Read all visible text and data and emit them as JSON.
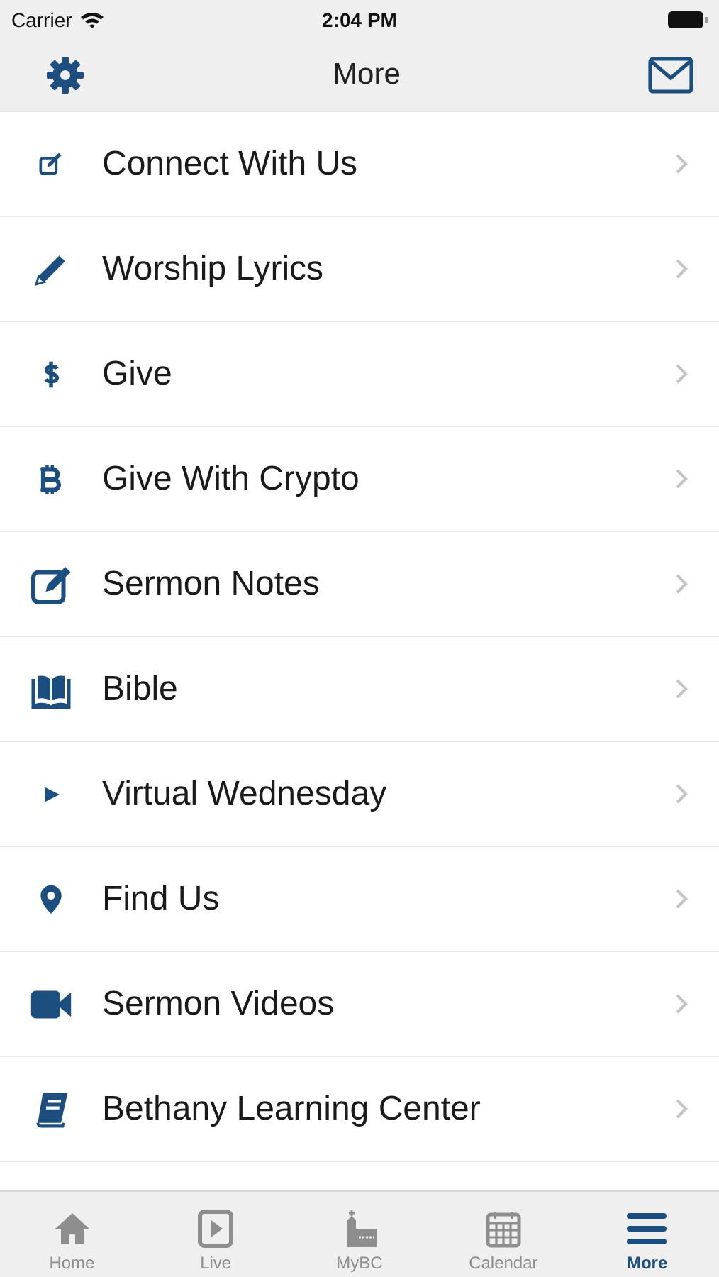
{
  "status_bar": {
    "carrier": "Carrier",
    "time": "2:04 PM"
  },
  "nav_bar": {
    "title": "More"
  },
  "menu_items": [
    {
      "label": "Connect With Us",
      "kind": "edit-small"
    },
    {
      "label": "Worship Lyrics",
      "kind": "pencil"
    },
    {
      "label": "Give",
      "kind": "dollar"
    },
    {
      "label": "Give With Crypto",
      "kind": "bitcoin"
    },
    {
      "label": "Sermon Notes",
      "kind": "edit"
    },
    {
      "label": "Bible",
      "kind": "book-open"
    },
    {
      "label": "Virtual Wednesday",
      "kind": "play"
    },
    {
      "label": "Find Us",
      "kind": "pin"
    },
    {
      "label": "Sermon Videos",
      "kind": "video"
    },
    {
      "label": "Bethany Learning Center",
      "kind": "book"
    }
  ],
  "tab_bar": [
    {
      "label": "Home",
      "kind": "home",
      "selected": false
    },
    {
      "label": "Live",
      "kind": "live",
      "selected": false
    },
    {
      "label": "MyBC",
      "kind": "church",
      "selected": false
    },
    {
      "label": "Calendar",
      "kind": "calendar",
      "selected": false
    },
    {
      "label": "More",
      "kind": "menu",
      "selected": true
    }
  ]
}
